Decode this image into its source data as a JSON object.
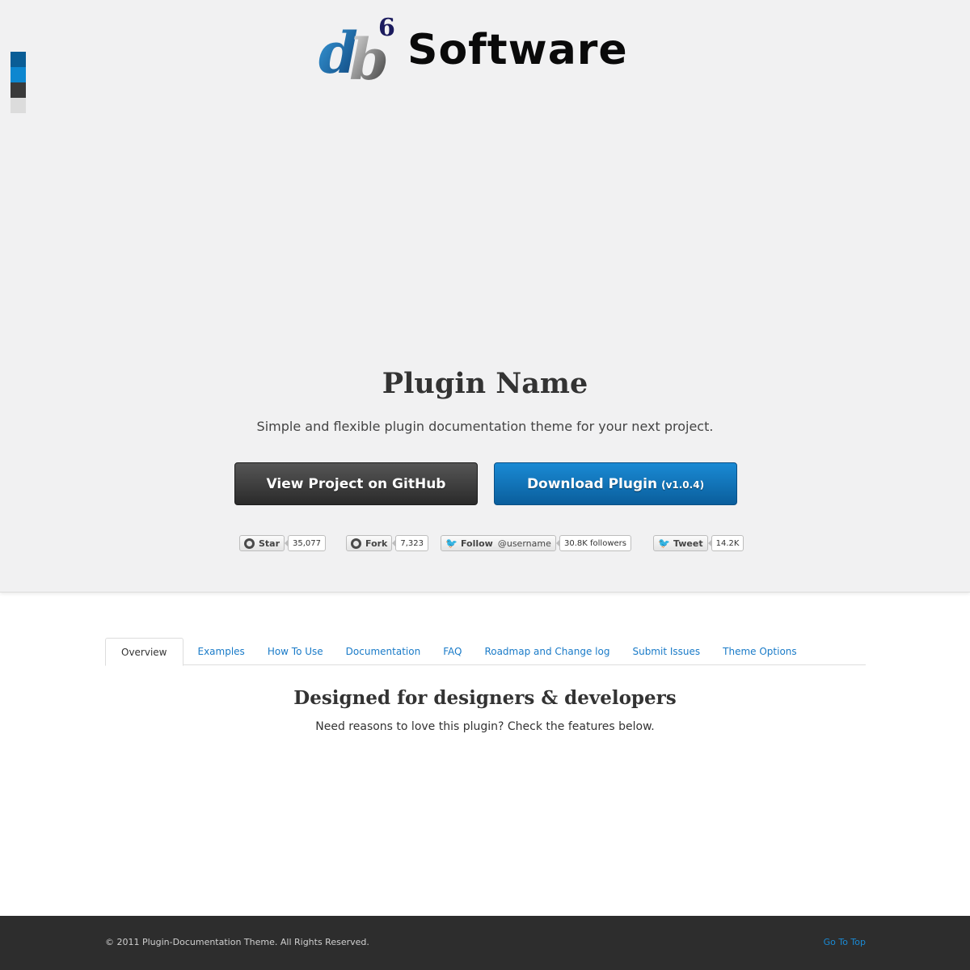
{
  "theme_swatches": {
    "colors": [
      "#0a5d96",
      "#0d87d0",
      "#3a3a3a",
      "#dcdcdc"
    ]
  },
  "header": {
    "logo": {
      "mark_text": "db6",
      "word": "Software",
      "colors": {
        "d": "#1565a8",
        "b": "#6b6b6b",
        "six": "#1b1b5e"
      }
    },
    "title": "Plugin Name",
    "subtitle": "Simple and flexible plugin documentation theme for your next project.",
    "buttons": {
      "github_label": "View Project on GitHub",
      "download_label": "Download Plugin",
      "download_version": "(v1.0.4)"
    },
    "social": {
      "star": {
        "label": "Star",
        "count": "35,077"
      },
      "fork": {
        "label": "Fork",
        "count": "7,323"
      },
      "follow": {
        "label": "Follow",
        "user": "@username",
        "count": "30.8K followers"
      },
      "tweet": {
        "label": "Tweet",
        "count": "14.2K"
      }
    }
  },
  "tabs": [
    {
      "label": "Overview",
      "active": true
    },
    {
      "label": "Examples"
    },
    {
      "label": "How To Use"
    },
    {
      "label": "Documentation"
    },
    {
      "label": "FAQ"
    },
    {
      "label": "Roadmap and Change log"
    },
    {
      "label": "Submit Issues"
    },
    {
      "label": "Theme Options"
    }
  ],
  "overview": {
    "title": "Designed for designers & developers",
    "subtitle": "Need reasons to love this plugin? Check the features below."
  },
  "footer": {
    "copyright": "© 2011 Plugin-Documentation Theme. All Rights Reserved.",
    "go_to_top": "Go To Top"
  }
}
